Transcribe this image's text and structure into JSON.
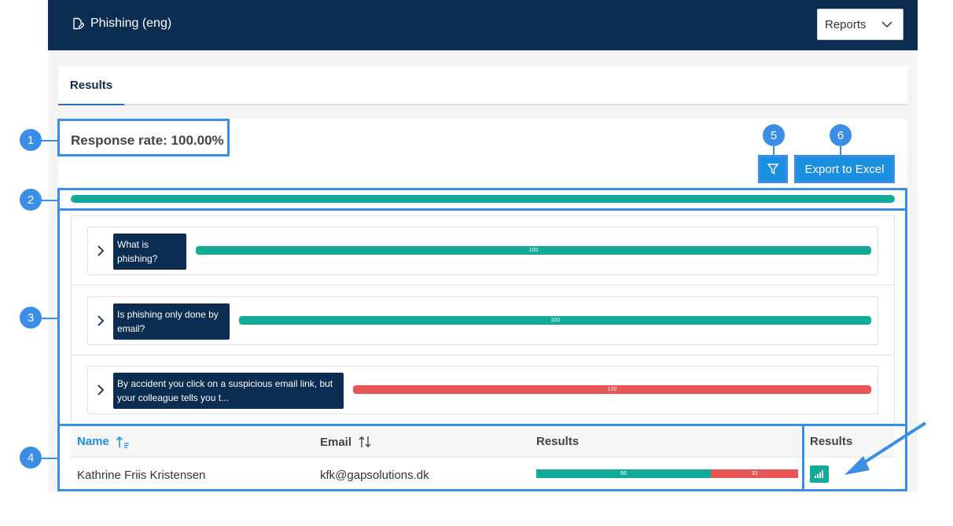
{
  "header": {
    "title": "Phishing (eng)",
    "reports_select": "Reports"
  },
  "tabs": [
    {
      "label": "Results"
    }
  ],
  "summary": {
    "response_rate": "Response rate: 100.00%"
  },
  "toolbar": {
    "export_label": "Export to Excel"
  },
  "overall": {
    "percent": 100,
    "color": "#11ab98"
  },
  "questions": [
    {
      "line1": "What is",
      "line2": "phishing?",
      "value": "100",
      "percent": 100,
      "color": "#11ab98"
    },
    {
      "line1": "Is phishing only done by",
      "line2": "email?",
      "value": "100",
      "percent": 100,
      "color": "#11ab98"
    },
    {
      "line1": "By accident you click on a suspicious email link, but",
      "line2": "your colleague tells you t...",
      "value": "100",
      "percent": 100,
      "color": "#e85555"
    }
  ],
  "table": {
    "columns": {
      "name": "Name",
      "email": "Email",
      "results": "Results",
      "results2": "Results"
    },
    "rows": [
      {
        "name": "Kathrine Friis Kristensen",
        "email": "kfk@gapsolutions.dk",
        "correct": "66",
        "wrong": "33",
        "correct_pct": 66,
        "wrong_pct": 33
      }
    ]
  },
  "callouts": [
    "1",
    "2",
    "3",
    "4",
    "5",
    "6"
  ],
  "colors": {
    "accent": "#3a8ee8",
    "navy": "#0c2d52",
    "teal": "#11ab98",
    "red": "#e85555",
    "button": "#1a8fe0"
  }
}
